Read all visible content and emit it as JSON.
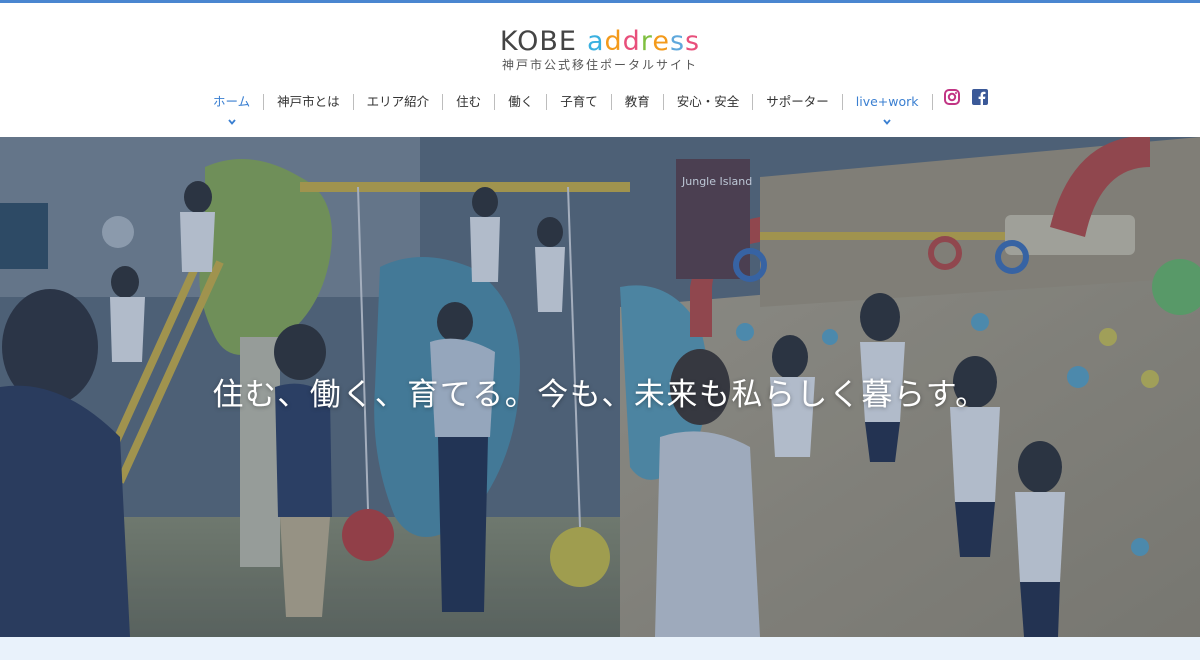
{
  "logo": {
    "kobe": "KOBE",
    "address_letters": [
      "a",
      "d",
      "d",
      "r",
      "e",
      "s",
      "s"
    ],
    "address_colors": [
      "#3ab0e0",
      "#f39a1b",
      "#e84f7b",
      "#7fbf3f",
      "#f39a1b",
      "#5fa8dc",
      "#e84f7b"
    ],
    "subtitle": "神戸市公式移住ポータルサイト"
  },
  "nav": {
    "items": [
      {
        "label": "ホーム",
        "active": true
      },
      {
        "label": "神戸市とは"
      },
      {
        "label": "エリア紹介"
      },
      {
        "label": "住む"
      },
      {
        "label": "働く"
      },
      {
        "label": "子育て"
      },
      {
        "label": "教育"
      },
      {
        "label": "安心・安全"
      },
      {
        "label": "サポーター"
      },
      {
        "label": "live+work"
      }
    ]
  },
  "social": {
    "instagram_icon": "instagram-icon",
    "facebook_icon": "facebook-icon",
    "instagram_color": "#c13584",
    "facebook_color": "#3b5998"
  },
  "hero": {
    "tagline": "住む、働く、育てる。今も、未来も私らしく暮らす。",
    "sign_text": "Jungle Island"
  },
  "colors": {
    "accent": "#3a7fd1",
    "top_line": "#4a86d0"
  }
}
